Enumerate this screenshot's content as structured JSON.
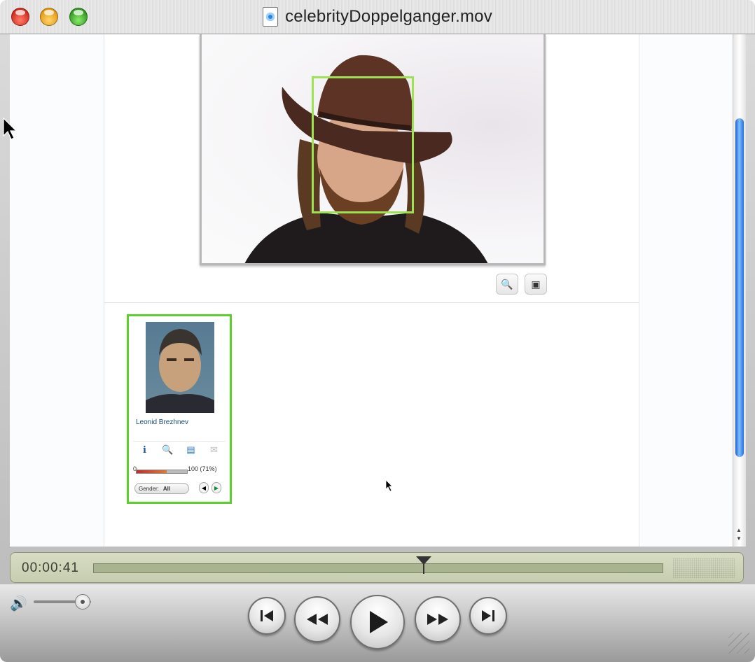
{
  "window": {
    "title": "celebrityDoppelganger.mov"
  },
  "match_card": {
    "name": "Leonid Brezhnev",
    "slider_min": "0",
    "slider_value_label": "100 (71%)",
    "similarity_percent": 71,
    "gender_label": "Gender:",
    "gender_value": "All"
  },
  "player": {
    "timecode": "00:00:41",
    "playhead_fraction": 0.58,
    "volume_fraction": 0.85
  },
  "colors": {
    "face_box": "#9be350",
    "card_border": "#5ad22b",
    "scroll_thumb": "#2a6fe0"
  }
}
